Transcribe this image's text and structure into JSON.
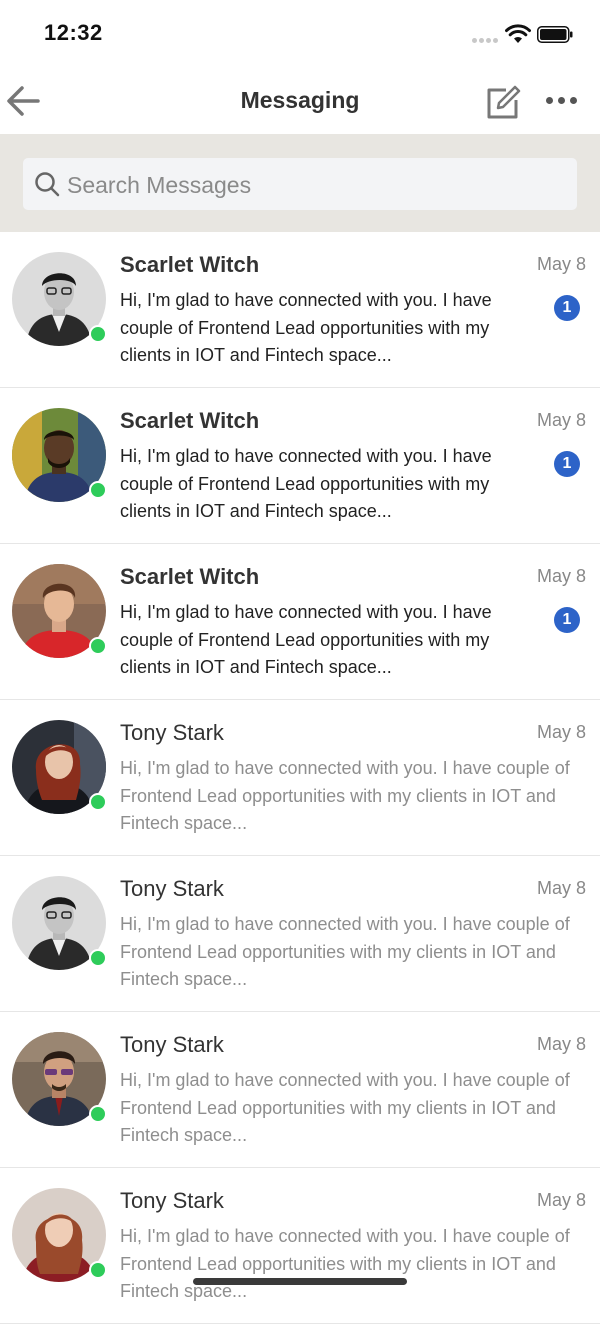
{
  "status": {
    "time": "12:32"
  },
  "header": {
    "title": "Messaging"
  },
  "search": {
    "placeholder": "Search Messages"
  },
  "conversations": [
    {
      "name": "Scarlet Witch",
      "date": "May 8",
      "unread": true,
      "badge": "1",
      "preview": "Hi, I'm glad to have connected with you. I have couple of Frontend Lead opportunities with my clients in IOT and Fintech space..."
    },
    {
      "name": "Scarlet Witch",
      "date": "May 8",
      "unread": true,
      "badge": "1",
      "preview": "Hi, I'm glad to have connected with you. I have couple of Frontend Lead opportunities with my clients in IOT and Fintech space..."
    },
    {
      "name": "Scarlet Witch",
      "date": "May 8",
      "unread": true,
      "badge": "1",
      "preview": "Hi, I'm glad to have connected with you. I have couple of Frontend Lead opportunities with my clients in IOT and Fintech space..."
    },
    {
      "name": "Tony Stark",
      "date": "May 8",
      "unread": false,
      "preview": "Hi, I'm glad to have connected with you. I have couple of Frontend Lead opportunities with my clients in IOT and Fintech space..."
    },
    {
      "name": "Tony Stark",
      "date": "May 8",
      "unread": false,
      "preview": "Hi, I'm glad to have connected with you. I have couple of Frontend Lead opportunities with my clients in IOT and Fintech space..."
    },
    {
      "name": "Tony Stark",
      "date": "May 8",
      "unread": false,
      "preview": "Hi, I'm glad to have connected with you. I have couple of Frontend Lead opportunities with my clients in IOT and Fintech space..."
    },
    {
      "name": "Tony Stark",
      "date": "May 8",
      "unread": false,
      "preview": "Hi, I'm glad to have connected with you. I have couple of Frontend Lead opportunities with my clients in IOT and Fintech space..."
    }
  ],
  "colors": {
    "accent": "#2d63c8",
    "online": "#2ecc5a",
    "search_band": "#e8e6e1"
  },
  "icons": [
    "back-arrow-icon",
    "compose-icon",
    "more-icon",
    "search-icon",
    "wifi-icon",
    "battery-icon"
  ]
}
